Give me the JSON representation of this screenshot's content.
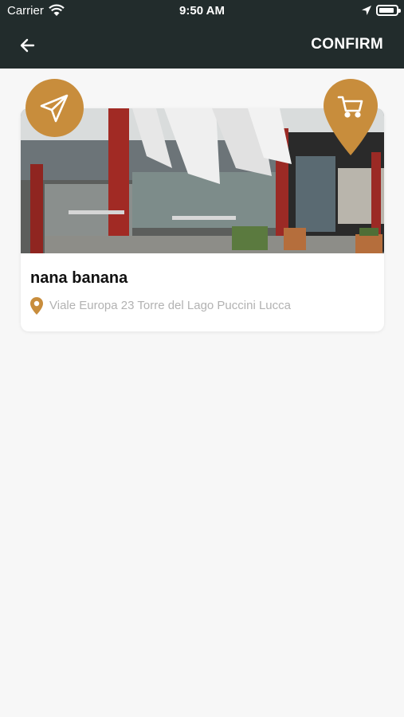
{
  "status_bar": {
    "carrier": "Carrier",
    "time": "9:50 AM",
    "battery_level": 0.9
  },
  "header": {
    "back_icon": "arrow-left-icon",
    "confirm_label": "CONFIRM"
  },
  "restaurant": {
    "name": "nana banana",
    "address": "Viale Europa 23 Torre del Lago Puccini Lucca",
    "photo_icon": "restaurant-terrace-photo"
  },
  "actions": {
    "send_icon": "paper-plane-icon",
    "cart_icon": "cart-pin-icon"
  },
  "colors": {
    "accent": "#c88d3c",
    "header_bg": "#222c2c",
    "background": "#f7f7f7"
  }
}
